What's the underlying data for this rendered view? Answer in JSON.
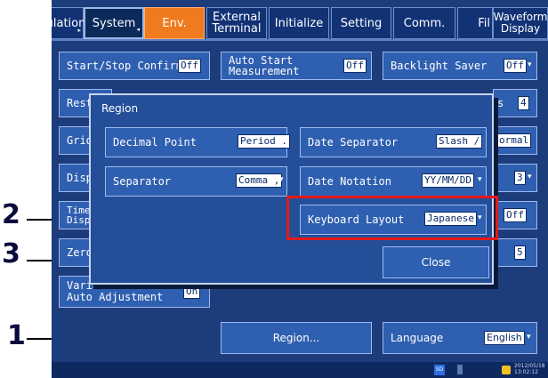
{
  "tabs": [
    {
      "label": "ulation",
      "arrow": "▸"
    },
    {
      "label": "System",
      "arrow": "◂"
    },
    {
      "label": "Env."
    },
    {
      "label": "External\nTerminal"
    },
    {
      "label": "Initialize"
    },
    {
      "label": "Setting"
    },
    {
      "label": "Comm."
    },
    {
      "label": "Fil"
    },
    {
      "label": "Waveform\nDisplay"
    }
  ],
  "settings": {
    "start_stop_confirm": {
      "label": "Start/Stop Confirm",
      "value": "Off"
    },
    "auto_start": {
      "label": "Auto Start\nMeasurement",
      "value": "Off"
    },
    "backlight_saver": {
      "label": "Backlight Saver",
      "value": "Off"
    },
    "resta": {
      "label": "Resta"
    },
    "row2_right_s": "s",
    "row2_right_val": "4",
    "grid": {
      "label": "Grid"
    },
    "grid_right_val": "ormal",
    "displa": {
      "label": "Displa"
    },
    "displa_right_val": "3",
    "time": {
      "label": "Time\nDispla"
    },
    "time_right_val": "Off",
    "zero": {
      "label": "Zero"
    },
    "zero_right_val": "5",
    "variable": {
      "label": "Variable\nAuto Adjustment",
      "value": "On"
    },
    "region_button": {
      "label": "Region..."
    },
    "language": {
      "label": "Language",
      "value": "English"
    }
  },
  "dialog": {
    "title": "Region",
    "decimal_point": {
      "label": "Decimal Point",
      "value": "Period ."
    },
    "date_separator": {
      "label": "Date Separator",
      "value": "Slash /"
    },
    "separator": {
      "label": "Separator",
      "value": "Comma ,"
    },
    "date_notation": {
      "label": "Date Notation",
      "value": "YY/MM/DD"
    },
    "keyboard_layout": {
      "label": "Keyboard Layout",
      "value": "Japanese"
    },
    "close_label": "Close"
  },
  "status": {
    "sd": "SD",
    "datetime": "2012/05/18\n13:02:12"
  },
  "markers": {
    "m1": "1",
    "m2": "2",
    "m3": "3"
  },
  "colors": {
    "highlight": "#e21a1a",
    "env_tab": "#f07a1e",
    "background": "#1c3c7c"
  }
}
